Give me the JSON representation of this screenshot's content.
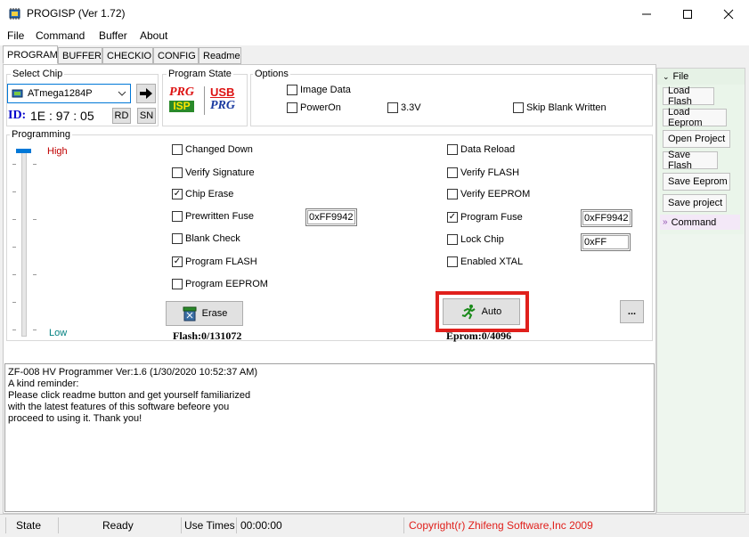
{
  "window": {
    "title": "PROGISP (Ver 1.72)"
  },
  "menu": [
    "File",
    "Command",
    "Buffer",
    "About"
  ],
  "tabs": [
    "PROGRAM",
    "BUFFER",
    "CHECKIO",
    "CONFIG",
    "Readme"
  ],
  "select_chip": {
    "label": "Select Chip",
    "value": "ATmega1284P",
    "id_label": "ID:",
    "id_value": "1E : 97 : 05",
    "rd": "RD",
    "sn": "SN"
  },
  "program_state": {
    "label": "Program State",
    "prg_isp_top": "PRG",
    "prg_isp_bottom": "ISP",
    "usb_top": "USB",
    "usb_bottom": "PRG"
  },
  "options": {
    "label": "Options",
    "image_data": "Image Data",
    "power_on": "PowerOn",
    "v33": "3.3V",
    "skip_blank": "Skip Blank Written"
  },
  "programming": {
    "label": "Programming",
    "high": "High",
    "low": "Low",
    "left": [
      {
        "label": "Changed Down",
        "checked": ""
      },
      {
        "label": "Verify Signature",
        "checked": ""
      },
      {
        "label": "Chip Erase",
        "checked": "✓"
      },
      {
        "label": "Prewritten Fuse",
        "checked": ""
      },
      {
        "label": "Blank Check",
        "checked": ""
      },
      {
        "label": "Program FLASH",
        "checked": "✓"
      },
      {
        "label": "Program EEPROM",
        "checked": ""
      }
    ],
    "right": [
      {
        "label": "Data Reload",
        "checked": ""
      },
      {
        "label": "Verify FLASH",
        "checked": ""
      },
      {
        "label": "Verify EEPROM",
        "checked": ""
      },
      {
        "label": "Program Fuse",
        "checked": "✓"
      },
      {
        "label": "Lock Chip",
        "checked": ""
      },
      {
        "label": "Enabled XTAL",
        "checked": ""
      }
    ],
    "prewritten_fuse_value": "0xFF9942",
    "program_fuse_value": "0xFF9942",
    "lock_chip_value": "0xFF",
    "erase_button": "Erase",
    "auto_button": "Auto",
    "more_button": "...",
    "flash_info": "Flash:0/131072",
    "eprom_info": "Eprom:0/4096"
  },
  "log_lines": [
    "ZF-008 HV Programmer Ver:1.6 (1/30/2020 10:52:37 AM)",
    "A kind reminder:",
    "Please click readme button and get yourself familiarized",
    "with the latest features of this software befeore you",
    "proceed to using it. Thank you!"
  ],
  "side": {
    "file_header": "File",
    "buttons": [
      "Load Flash",
      "Load Eeprom",
      "Open Project",
      "Save Flash",
      "Save Eeprom",
      "Save project"
    ],
    "command_header": "Command"
  },
  "status": {
    "state": "State",
    "ready": "Ready",
    "use_times": "Use Times",
    "time": "00:00:00",
    "copyright": "Copyright(r) Zhifeng Software,Inc 2009"
  },
  "colors": {
    "accent_red": "#e0201c",
    "high_red": "#c00000",
    "low_teal": "#008080"
  }
}
